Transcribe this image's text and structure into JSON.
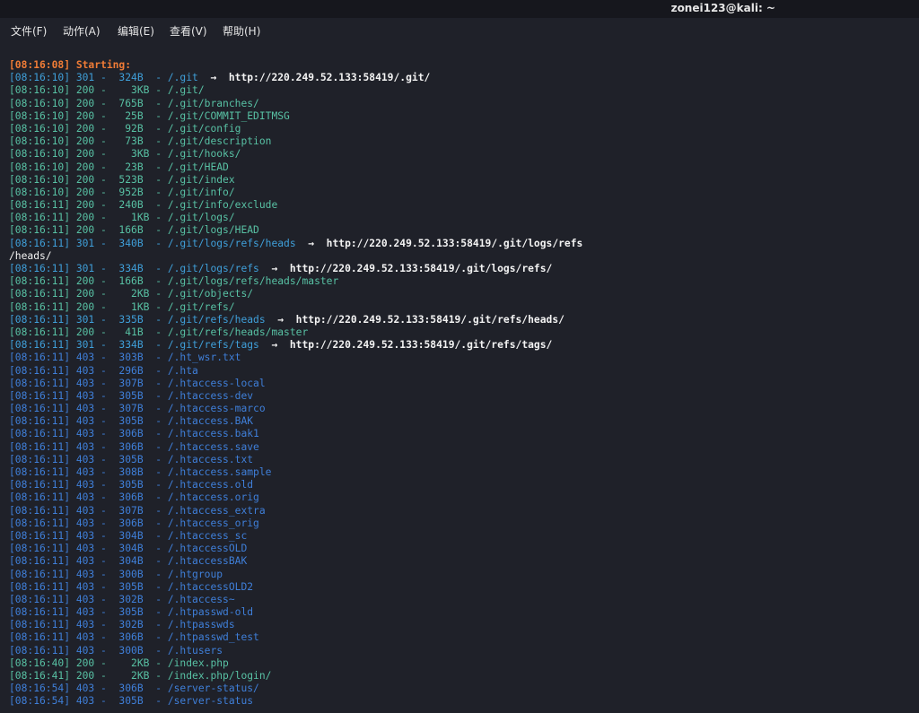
{
  "window": {
    "title": "zonei123@kali: ~"
  },
  "menu": {
    "items": [
      {
        "id": "file",
        "label": "文件(F)"
      },
      {
        "id": "action",
        "label": "动作(A)"
      },
      {
        "id": "edit",
        "label": "编辑(E)"
      },
      {
        "id": "view",
        "label": "查看(V)"
      },
      {
        "id": "help",
        "label": "帮助(H)"
      }
    ]
  },
  "colors": {
    "background": "#1f2129",
    "starting": "#f07c36",
    "status_301": "#3f9fd9",
    "status_200": "#58c1a4",
    "status_403": "#3f7fd9",
    "redirect_text": "#f3f3f3"
  },
  "terminal": {
    "starting_line": "[08:16:08] Starting:",
    "lines": [
      {
        "kind": "301",
        "text": "[08:16:10] 301 -  324B  - /.git",
        "redirect": "  →  http://220.249.52.133:58419/.git/"
      },
      {
        "kind": "200",
        "text": "[08:16:10] 200 -    3KB - /.git/"
      },
      {
        "kind": "200",
        "text": "[08:16:10] 200 -  765B  - /.git/branches/"
      },
      {
        "kind": "200",
        "text": "[08:16:10] 200 -   25B  - /.git/COMMIT_EDITMSG"
      },
      {
        "kind": "200",
        "text": "[08:16:10] 200 -   92B  - /.git/config"
      },
      {
        "kind": "200",
        "text": "[08:16:10] 200 -   73B  - /.git/description"
      },
      {
        "kind": "200",
        "text": "[08:16:10] 200 -    3KB - /.git/hooks/"
      },
      {
        "kind": "200",
        "text": "[08:16:10] 200 -   23B  - /.git/HEAD"
      },
      {
        "kind": "200",
        "text": "[08:16:10] 200 -  523B  - /.git/index"
      },
      {
        "kind": "200",
        "text": "[08:16:10] 200 -  952B  - /.git/info/"
      },
      {
        "kind": "200",
        "text": "[08:16:11] 200 -  240B  - /.git/info/exclude"
      },
      {
        "kind": "200",
        "text": "[08:16:11] 200 -    1KB - /.git/logs/"
      },
      {
        "kind": "200",
        "text": "[08:16:11] 200 -  166B  - /.git/logs/HEAD"
      },
      {
        "kind": "301",
        "text": "[08:16:11] 301 -  340B  - /.git/logs/refs/heads",
        "redirect": "  →  http://220.249.52.133:58419/.git/logs/refs"
      },
      {
        "kind": "wrap",
        "text": "/heads/"
      },
      {
        "kind": "301",
        "text": "[08:16:11] 301 -  334B  - /.git/logs/refs",
        "redirect": "  →  http://220.249.52.133:58419/.git/logs/refs/"
      },
      {
        "kind": "200",
        "text": "[08:16:11] 200 -  166B  - /.git/logs/refs/heads/master"
      },
      {
        "kind": "200",
        "text": "[08:16:11] 200 -    2KB - /.git/objects/"
      },
      {
        "kind": "200",
        "text": "[08:16:11] 200 -    1KB - /.git/refs/"
      },
      {
        "kind": "301",
        "text": "[08:16:11] 301 -  335B  - /.git/refs/heads",
        "redirect": "  →  http://220.249.52.133:58419/.git/refs/heads/"
      },
      {
        "kind": "200",
        "text": "[08:16:11] 200 -   41B  - /.git/refs/heads/master"
      },
      {
        "kind": "301",
        "text": "[08:16:11] 301 -  334B  - /.git/refs/tags",
        "redirect": "  →  http://220.249.52.133:58419/.git/refs/tags/"
      },
      {
        "kind": "403",
        "text": "[08:16:11] 403 -  303B  - /.ht_wsr.txt"
      },
      {
        "kind": "403",
        "text": "[08:16:11] 403 -  296B  - /.hta"
      },
      {
        "kind": "403",
        "text": "[08:16:11] 403 -  307B  - /.htaccess-local"
      },
      {
        "kind": "403",
        "text": "[08:16:11] 403 -  305B  - /.htaccess-dev"
      },
      {
        "kind": "403",
        "text": "[08:16:11] 403 -  307B  - /.htaccess-marco"
      },
      {
        "kind": "403",
        "text": "[08:16:11] 403 -  305B  - /.htaccess.BAK"
      },
      {
        "kind": "403",
        "text": "[08:16:11] 403 -  306B  - /.htaccess.bak1"
      },
      {
        "kind": "403",
        "text": "[08:16:11] 403 -  306B  - /.htaccess.save"
      },
      {
        "kind": "403",
        "text": "[08:16:11] 403 -  305B  - /.htaccess.txt"
      },
      {
        "kind": "403",
        "text": "[08:16:11] 403 -  308B  - /.htaccess.sample"
      },
      {
        "kind": "403",
        "text": "[08:16:11] 403 -  305B  - /.htaccess.old"
      },
      {
        "kind": "403",
        "text": "[08:16:11] 403 -  306B  - /.htaccess.orig"
      },
      {
        "kind": "403",
        "text": "[08:16:11] 403 -  307B  - /.htaccess_extra"
      },
      {
        "kind": "403",
        "text": "[08:16:11] 403 -  306B  - /.htaccess_orig"
      },
      {
        "kind": "403",
        "text": "[08:16:11] 403 -  304B  - /.htaccess_sc"
      },
      {
        "kind": "403",
        "text": "[08:16:11] 403 -  304B  - /.htaccessOLD"
      },
      {
        "kind": "403",
        "text": "[08:16:11] 403 -  304B  - /.htaccessBAK"
      },
      {
        "kind": "403",
        "text": "[08:16:11] 403 -  300B  - /.htgroup"
      },
      {
        "kind": "403",
        "text": "[08:16:11] 403 -  305B  - /.htaccessOLD2"
      },
      {
        "kind": "403",
        "text": "[08:16:11] 403 -  302B  - /.htaccess~"
      },
      {
        "kind": "403",
        "text": "[08:16:11] 403 -  305B  - /.htpasswd-old"
      },
      {
        "kind": "403",
        "text": "[08:16:11] 403 -  302B  - /.htpasswds"
      },
      {
        "kind": "403",
        "text": "[08:16:11] 403 -  306B  - /.htpasswd_test"
      },
      {
        "kind": "403",
        "text": "[08:16:11] 403 -  300B  - /.htusers"
      },
      {
        "kind": "200",
        "text": "[08:16:40] 200 -    2KB - /index.php"
      },
      {
        "kind": "200",
        "text": "[08:16:41] 200 -    2KB - /index.php/login/"
      },
      {
        "kind": "403",
        "text": "[08:16:54] 403 -  306B  - /server-status/"
      },
      {
        "kind": "403",
        "text": "[08:16:54] 403 -  305B  - /server-status"
      }
    ]
  }
}
